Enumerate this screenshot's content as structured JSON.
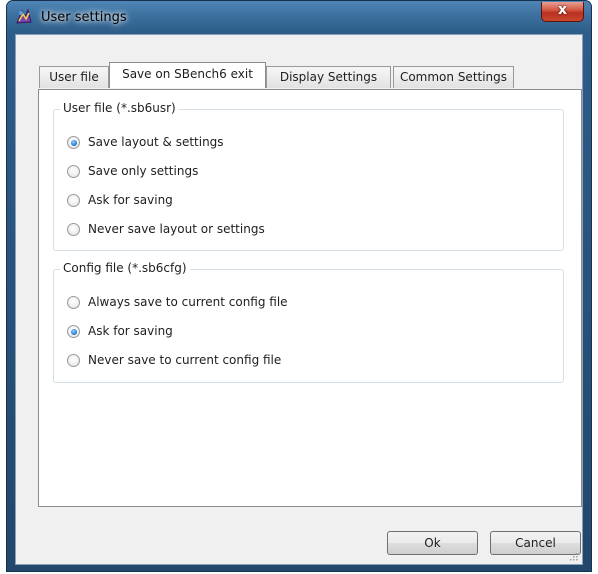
{
  "window": {
    "title": "User settings",
    "close_label": "x"
  },
  "tabs": [
    {
      "label": "User file",
      "active": false
    },
    {
      "label": "Save on SBench6 exit",
      "active": true
    },
    {
      "label": "Display Settings",
      "active": false
    },
    {
      "label": "Common Settings",
      "active": false
    }
  ],
  "user_file_group": {
    "legend": "User file (*.sb6usr)",
    "options": [
      {
        "label": "Save layout & settings",
        "checked": true
      },
      {
        "label": "Save only settings",
        "checked": false
      },
      {
        "label": "Ask for saving",
        "checked": false
      },
      {
        "label": "Never save layout or settings",
        "checked": false
      }
    ]
  },
  "config_file_group": {
    "legend": "Config file (*.sb6cfg)",
    "options": [
      {
        "label": "Always save to current config file",
        "checked": false
      },
      {
        "label": "Ask for saving",
        "checked": true
      },
      {
        "label": "Never save to current config file",
        "checked": false
      }
    ]
  },
  "buttons": {
    "ok": "Ok",
    "cancel": "Cancel"
  },
  "colors": {
    "accent_radio": "#2b7fd6",
    "close_button": "#c9462f",
    "titlebar": "#3c6f9d"
  }
}
